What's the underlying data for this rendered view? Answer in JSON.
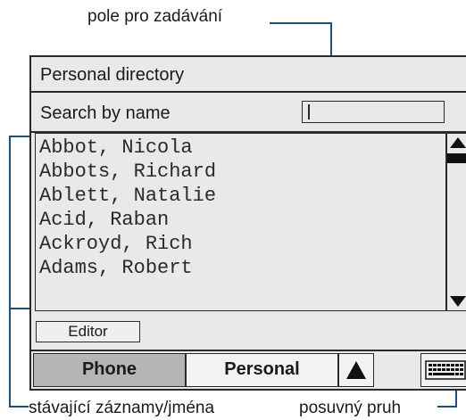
{
  "callouts": {
    "input_field": "pole pro zadávání",
    "existing_entries": "stávající záznamy/jména",
    "scrollbar": "posuvný pruh"
  },
  "window": {
    "title": "Personal directory"
  },
  "search": {
    "label": "Search by name",
    "value": ""
  },
  "entries": [
    "Abbot, Nicola",
    "Abbots, Richard",
    "Ablett, Natalie",
    "Acid, Raban",
    "Ackroyd, Rich",
    "Adams, Robert"
  ],
  "buttons": {
    "editor": "Editor"
  },
  "tabs": [
    {
      "label": "Phone",
      "selected": true
    },
    {
      "label": "Personal",
      "selected": false
    }
  ],
  "icons": [
    "scroll-up-arrow-icon",
    "scroll-down-arrow-icon",
    "tab-up-arrow-icon",
    "keyboard-icon"
  ],
  "colors": {
    "callout_line": "#1f4e79",
    "panel_bg": "#e9e9e9",
    "selected_tab": "#b5b5b5"
  }
}
